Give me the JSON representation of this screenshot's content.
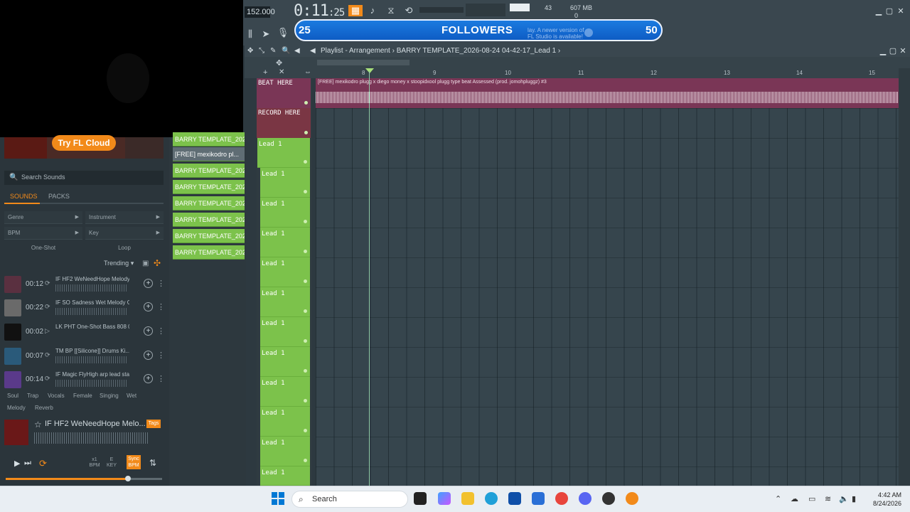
{
  "topbar": {
    "tempo": "152.000",
    "song_time_main": "0:11",
    "song_time_small": ":25",
    "cpu_value": "43",
    "memory": "607 MB",
    "voices": "0"
  },
  "overlay": {
    "followers_current": "25",
    "followers_title": "FOLLOWERS",
    "followers_goal": "50",
    "update_note": "lay. A newer version of FL Studio is available!"
  },
  "playlist": {
    "breadcrumb": "Playlist - Arrangement",
    "separator": "›",
    "project": "BARRY TEMPLATE_2026-08-24 04-42-17_Lead 1",
    "ruler_ticks": [
      "8",
      "9",
      "10",
      "11",
      "12",
      "13",
      "14",
      "15"
    ],
    "audio_clip_label": "[FREE] mexikodro plugg x diego money x stoopidxool plugg type beat Assessed (prod. jomohpluggz) #3",
    "tracks": {
      "beat": "BEAT HERE",
      "record": "RECORD HERE",
      "lead_label": "Lead 1",
      "lead_count": 12
    }
  },
  "clips": {
    "items": [
      "BARRY TEMPLATE_2026-",
      "[FREE] mexikodro pl...",
      "BARRY TEMPLATE_2026-",
      "BARRY TEMPLATE_2026-",
      "BARRY TEMPLATE_2026-",
      "BARRY TEMPLATE_2026-",
      "BARRY TEMPLATE_2026-",
      "BARRY TEMPLATE_2026-"
    ]
  },
  "browser": {
    "promo_button": "Try FL Cloud",
    "search_placeholder": "Search Sounds",
    "tabs": [
      "SOUNDS",
      "PACKS"
    ],
    "filters": [
      "Genre",
      "Instrument",
      "BPM",
      "Key"
    ],
    "segments": [
      "One-Shot",
      "Loop"
    ],
    "sort": "Trending",
    "sounds": [
      {
        "duration": "00:12",
        "name": "IF HF2 WeNeedHope Melody..."
      },
      {
        "duration": "00:22",
        "name": "IF SO Sadness Wet Melody G..."
      },
      {
        "duration": "00:02",
        "name": "LK PHT One-Shot Bass 808 04"
      },
      {
        "duration": "00:07",
        "name": "TM BP [[Silicone]] Drums Ki..."
      },
      {
        "duration": "00:14",
        "name": "IF Magic FlyHigh arp lead sta..."
      }
    ],
    "tags_row1": [
      "Soul",
      "Trap",
      "Vocals",
      "Female",
      "Singing",
      "Wet"
    ],
    "tags_row2": [
      "Melody",
      "Reverb"
    ],
    "preview": {
      "name": "IF HF2 WeNeedHope Melo...",
      "tags_button": "Tags"
    },
    "controls": {
      "bpm_label": "x1 BPM",
      "key_label": "E KEY",
      "sync_label": "Sync BPM"
    },
    "volume_fraction": 0.78
  },
  "taskbar": {
    "search": "Search",
    "time": "4:42 AM",
    "date": "8/24/2026"
  },
  "colors": {
    "accent": "#f28a1a",
    "lead_green": "#7cc24b",
    "beat_track": "#7a3656",
    "followers_blue": "#1b7be0"
  }
}
